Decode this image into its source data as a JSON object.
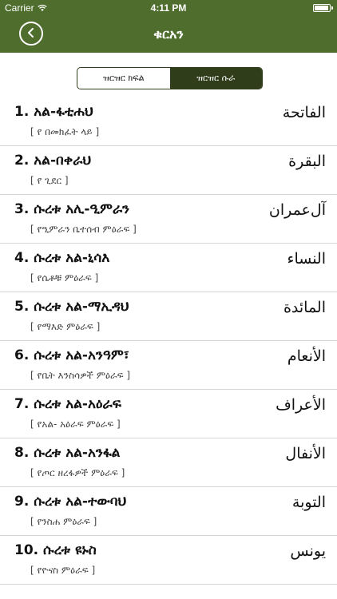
{
  "status_bar": {
    "carrier": "Carrier",
    "time": "4:11 PM",
    "battery_level": 0.95
  },
  "nav": {
    "title": "ቁርአን"
  },
  "segments": [
    {
      "label": "ዝርዝር ክፍል",
      "selected": false
    },
    {
      "label": "ዝርዝር ሱራ",
      "selected": true
    }
  ],
  "surahs": [
    {
      "title": "1.  አል-ፋቲሐህ",
      "arabic": "الفاتحة",
      "subtitle": "[ የ በመክፈት ላይ ]"
    },
    {
      "title": "2.  አል-በቀራህ",
      "arabic": "البقرة",
      "subtitle": "[ የ ጊደር ]"
    },
    {
      "title": "3.  ሱረቱ  አሊ-ዒምራን",
      "arabic": "آل‌عمران",
      "subtitle": "[ የዒምራን ቤተሰብ ምዕራፍ ]"
    },
    {
      "title": "4.  ሱረቱ  አል-ኒሳእ",
      "arabic": "النساء",
      "subtitle": "[ የሴቶቹ ምዕራፍ ]"
    },
    {
      "title": "5.  ሱረቱ  አል-ማኢዳህ",
      "arabic": "المائدة",
      "subtitle": "[ የማእድ ምዕራፍ ]"
    },
    {
      "title": "6.  ሱረቱ  አል-አንዓም፣",
      "arabic": "الأنعام",
      "subtitle": "[ የቤት እንስሳዎች ምዕራፍ ]"
    },
    {
      "title": "7.  ሱረቱ  አል-አዕራፍ",
      "arabic": "الأعراف",
      "subtitle": "[ የአል- አዕራፍ ምዕራፍ ]"
    },
    {
      "title": "8.  ሱረቱ  አል-አንፋል",
      "arabic": "الأنفال",
      "subtitle": "[ የጦር ዘረፋዎች ምዕራፍ ]"
    },
    {
      "title": "9.  ሱረቱ  አል-ተውባህ",
      "arabic": "التوبة",
      "subtitle": "[ የንስሐ ምዕራፍ ]"
    },
    {
      "title": "10.  ሱረቱ  ዩኑስ",
      "arabic": "يونس",
      "subtitle": "[ የዮናስ ምዕራፍ ]"
    }
  ]
}
